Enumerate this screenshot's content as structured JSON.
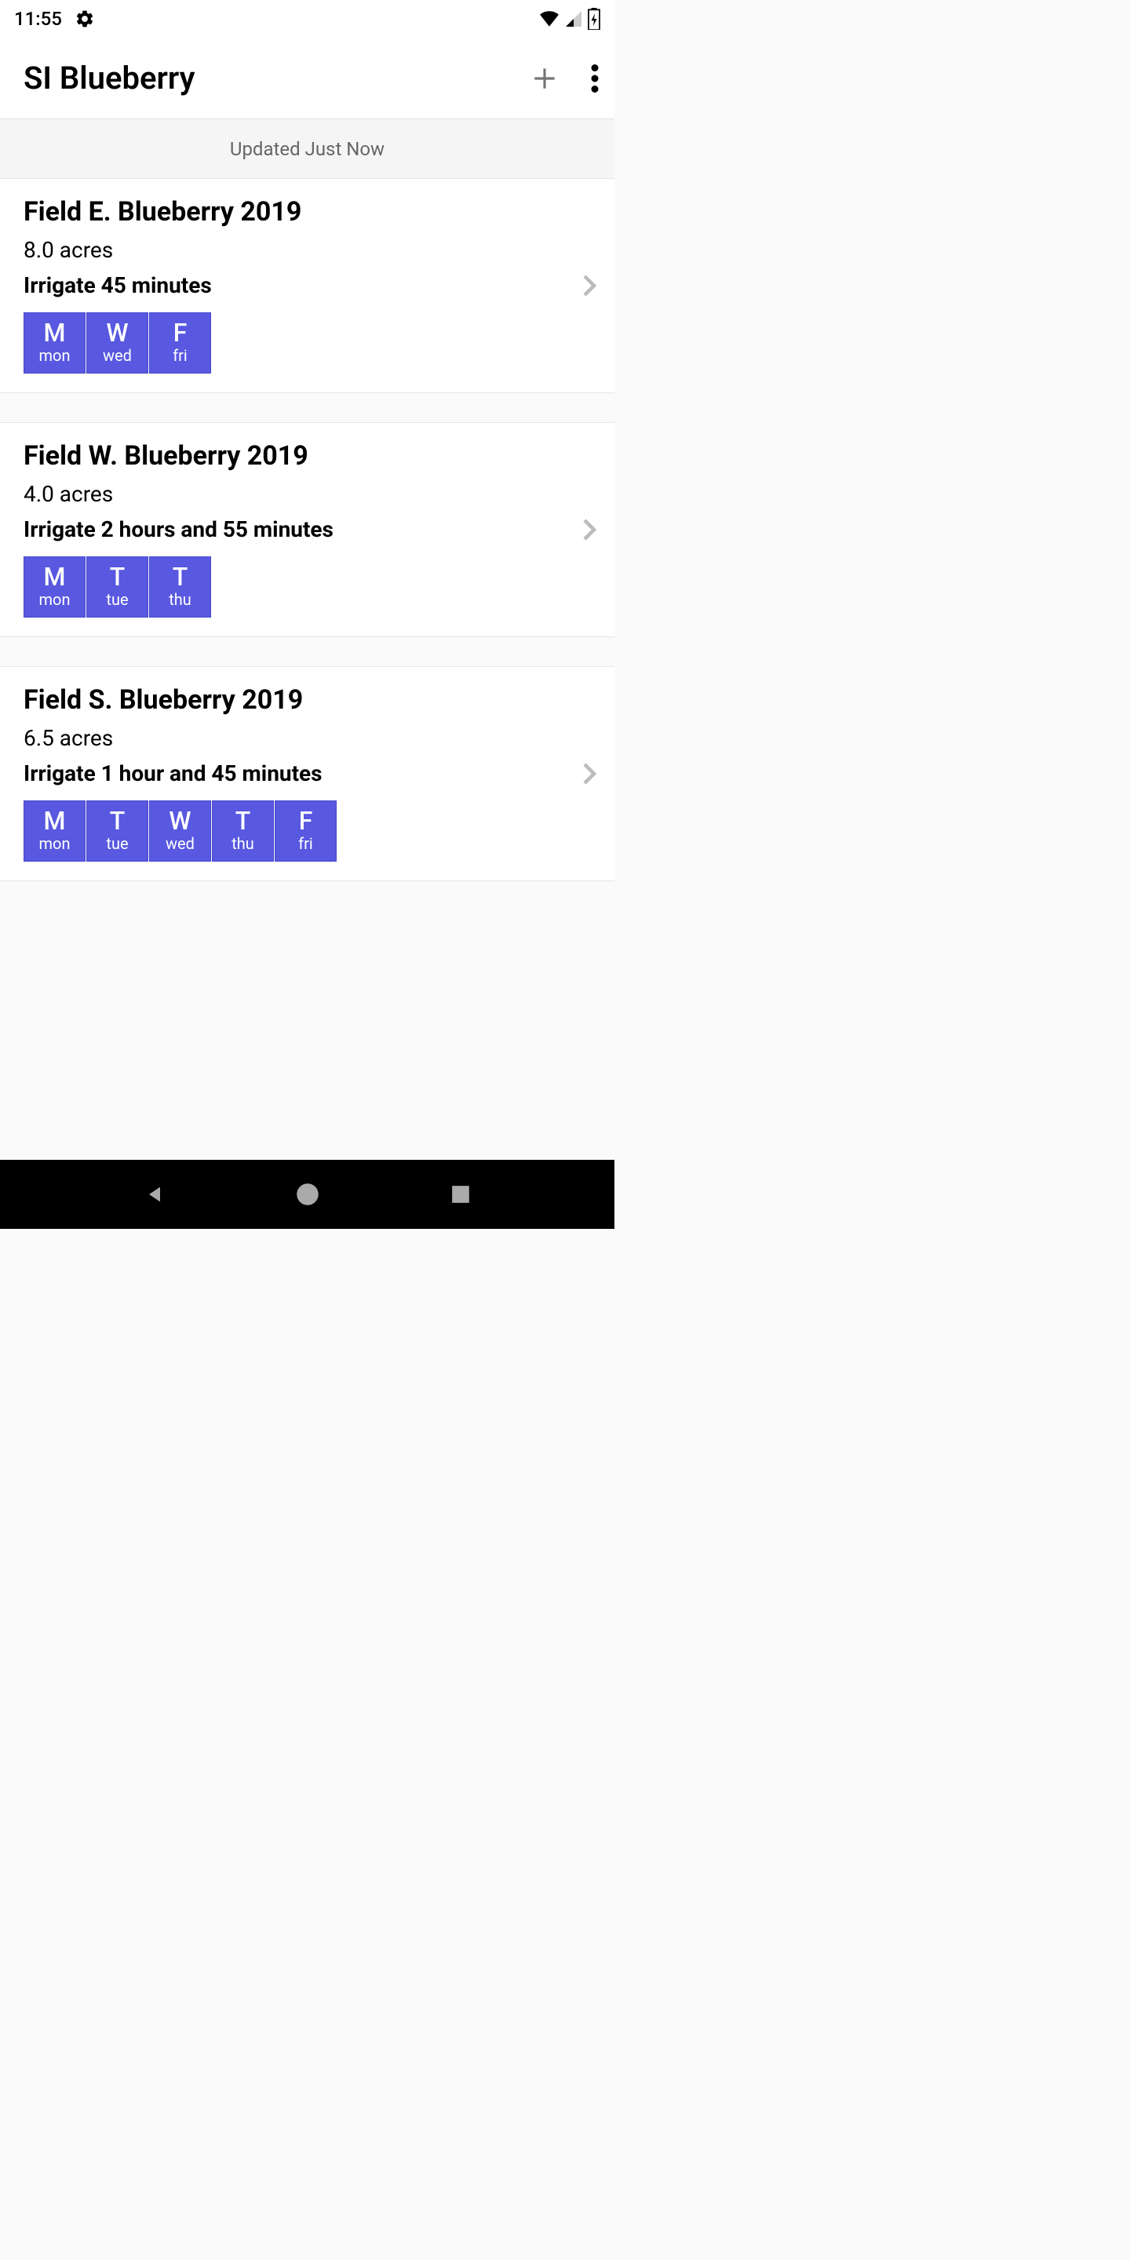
{
  "statusBar": {
    "time": "11:55"
  },
  "appBar": {
    "title": "SI Blueberry"
  },
  "updateBanner": {
    "text": "Updated Just Now"
  },
  "fields": [
    {
      "name": "Field E. Blueberry 2019",
      "acres": "8.0 acres",
      "irrigate": "Irrigate 45 minutes",
      "days": [
        {
          "letter": "M",
          "name": "mon"
        },
        {
          "letter": "W",
          "name": "wed"
        },
        {
          "letter": "F",
          "name": "fri"
        }
      ]
    },
    {
      "name": "Field W. Blueberry 2019",
      "acres": "4.0 acres",
      "irrigate": "Irrigate 2 hours and 55 minutes",
      "days": [
        {
          "letter": "M",
          "name": "mon"
        },
        {
          "letter": "T",
          "name": "tue"
        },
        {
          "letter": "T",
          "name": "thu"
        }
      ]
    },
    {
      "name": "Field S. Blueberry 2019",
      "acres": "6.5 acres",
      "irrigate": "Irrigate 1 hour and 45 minutes",
      "days": [
        {
          "letter": "M",
          "name": "mon"
        },
        {
          "letter": "T",
          "name": "tue"
        },
        {
          "letter": "W",
          "name": "wed"
        },
        {
          "letter": "T",
          "name": "thu"
        },
        {
          "letter": "F",
          "name": "fri"
        }
      ]
    }
  ]
}
